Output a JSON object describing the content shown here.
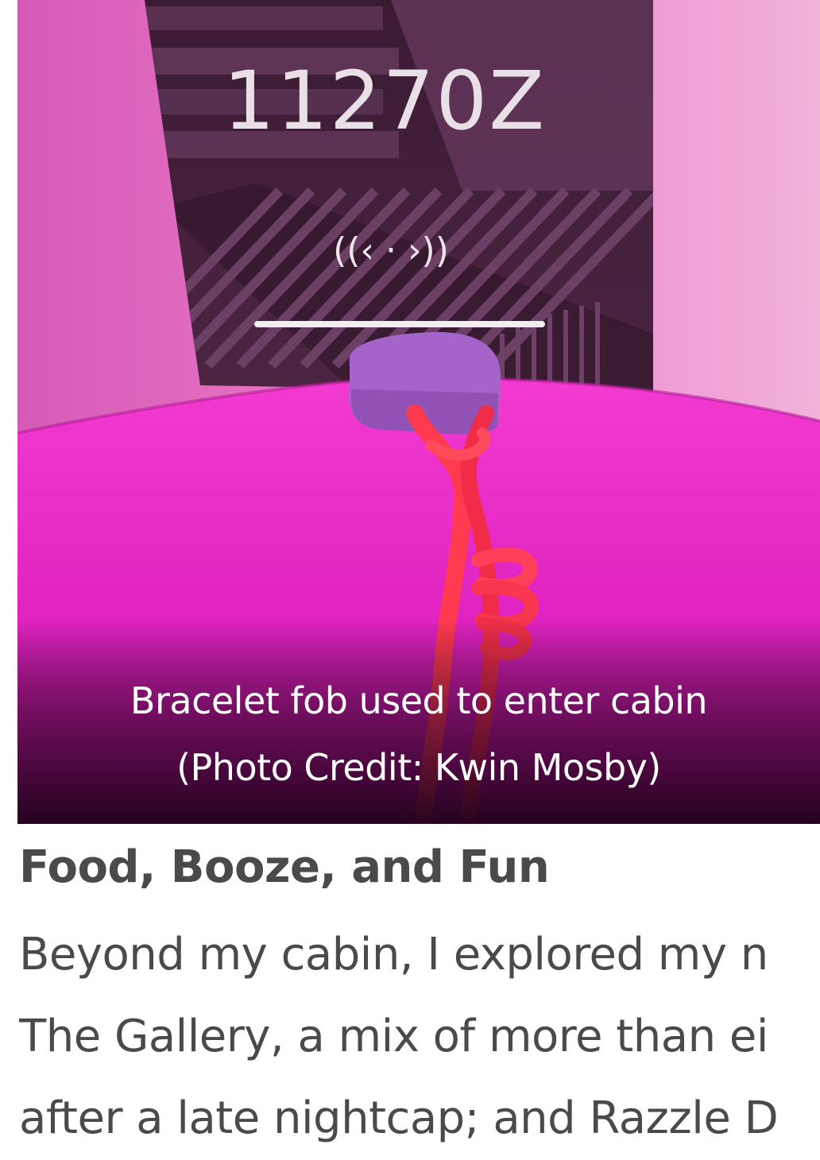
{
  "figure": {
    "display_code": "11270Z",
    "reader_symbol": "((‹ · ›))",
    "caption_line1": "Bracelet fob used to enter cabin",
    "caption_line2": "(Photo Credit: Kwin Mosby)"
  },
  "article": {
    "heading": "Food, Booze, and Fun",
    "lines": [
      "Beyond my cabin, I explored my n",
      "The Gallery, a mix of more than ei",
      "after a late nightcap; and Razzle D"
    ]
  }
}
